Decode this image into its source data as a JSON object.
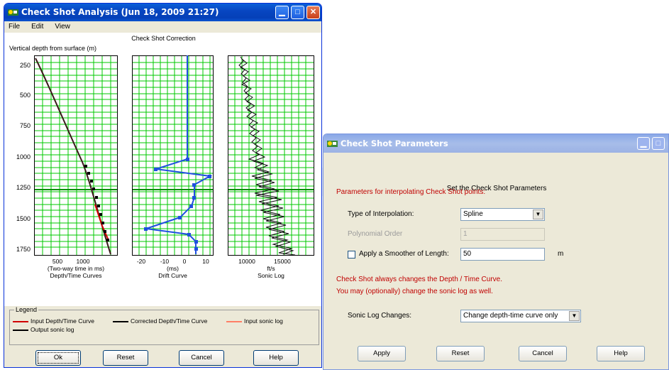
{
  "window1": {
    "title": "Check Shot Analysis  (Jun 18, 2009  21:27)",
    "menu": [
      "File",
      "Edit",
      "View"
    ],
    "plot_title": "Check Shot Correction",
    "y_axis_label": "Vertical depth from surface (m)",
    "y_ticks": [
      "250",
      "500",
      "750",
      "1000",
      "1250",
      "1500",
      "1750"
    ],
    "panels": [
      {
        "ticks": [
          "500",
          "1000"
        ],
        "label1": "(Two-way time in ms)",
        "label2": "Depth/Time Curves"
      },
      {
        "ticks": [
          "-20",
          "-10",
          "0",
          "10"
        ],
        "label1": "(ms)",
        "label2": "Drift Curve"
      },
      {
        "ticks": [
          "10000",
          "15000"
        ],
        "label1": "ft/s",
        "label2": "Sonic Log"
      }
    ],
    "legend": {
      "title": "Legend",
      "items": [
        {
          "label": "Input Depth/Time Curve",
          "color": "#d00000"
        },
        {
          "label": "Corrected Depth/Time Curve",
          "color": "#000000"
        },
        {
          "label": "Input sonic log",
          "color": "#ff7f66"
        },
        {
          "label": "Output sonic log",
          "color": "#000000"
        }
      ]
    },
    "buttons": {
      "ok": "Ok",
      "reset": "Reset",
      "cancel": "Cancel",
      "help": "Help"
    }
  },
  "window2": {
    "title": "Check Shot Parameters",
    "heading": "Set the Check Shot Parameters",
    "section_label": "Parameters for interpolating Check Shot points:",
    "interp_label": "Type of Interpolation:",
    "interp_value": "Spline",
    "poly_label": "Polynomial Order",
    "poly_value": "1",
    "smoother_label": "Apply a Smoother of Length:",
    "smoother_value": "50",
    "smoother_unit": "m",
    "note1": "Check Shot always changes the Depth / Time Curve.",
    "note2": "You may (optionally) change the sonic log as well.",
    "sonic_label": "Sonic Log Changes:",
    "sonic_value": "Change depth-time curve only",
    "buttons": {
      "apply": "Apply",
      "reset": "Reset",
      "cancel": "Cancel",
      "help": "Help"
    }
  },
  "colors": {
    "grid": "#00c800",
    "drift": "#1f4fe0",
    "input_dt": "#d00000",
    "title_active": "#0846c2",
    "title_inactive": "#9cb2e4"
  }
}
